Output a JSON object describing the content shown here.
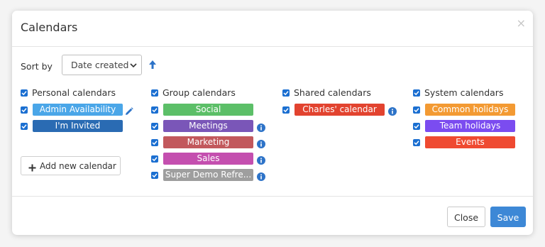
{
  "dialog": {
    "title": "Calendars",
    "close_glyph": "×"
  },
  "sort": {
    "label": "Sort by",
    "selected": "Date created",
    "direction_icon": "arrow-up-icon"
  },
  "columns": [
    {
      "header": "Personal calendars",
      "items": [
        {
          "label": "Admin Availability",
          "color": "#4aa6e8",
          "icon": "pencil-icon"
        },
        {
          "label": "I'm Invited",
          "color": "#2a6bb3",
          "icon": ""
        }
      ],
      "add_button": "Add new calendar"
    },
    {
      "header": "Group calendars",
      "items": [
        {
          "label": "Social",
          "color": "#5cbf68",
          "icon": ""
        },
        {
          "label": "Meetings",
          "color": "#7a56b8",
          "icon": "info-icon"
        },
        {
          "label": "Marketing",
          "color": "#c2585c",
          "icon": "info-icon"
        },
        {
          "label": "Sales",
          "color": "#c44faf",
          "icon": "info-icon"
        },
        {
          "label": "Super Demo Refre...",
          "color": "#9e9e9e",
          "icon": "info-icon"
        }
      ]
    },
    {
      "header": "Shared calendars",
      "items": [
        {
          "label": "Charles' calendar",
          "color": "#e2432f",
          "icon": "info-icon"
        }
      ]
    },
    {
      "header": "System calendars",
      "items": [
        {
          "label": "Common holidays",
          "color": "#f39a33",
          "icon": ""
        },
        {
          "label": "Team holidays",
          "color": "#7b4cf0",
          "icon": ""
        },
        {
          "label": "Events",
          "color": "#ef4a31",
          "icon": ""
        }
      ]
    }
  ],
  "footer": {
    "close_label": "Close",
    "save_label": "Save"
  }
}
